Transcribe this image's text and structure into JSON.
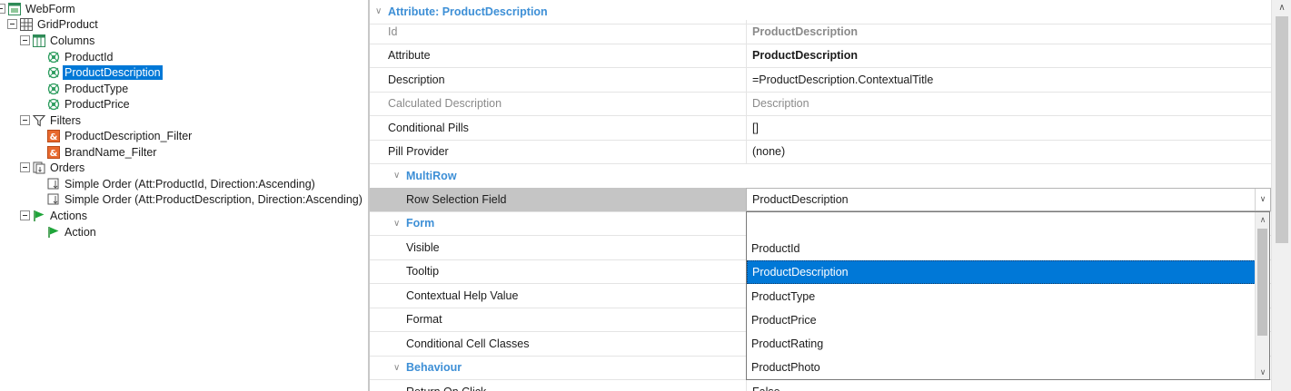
{
  "tree": {
    "root": "WebForm",
    "grid": "GridProduct",
    "columns": {
      "label": "Columns",
      "items": [
        "ProductId",
        "ProductDescription",
        "ProductType",
        "ProductPrice"
      ]
    },
    "filters": {
      "label": "Filters",
      "items": [
        "ProductDescription_Filter",
        "BrandName_Filter"
      ]
    },
    "orders": {
      "label": "Orders",
      "items": [
        "Simple Order (Att:ProductId, Direction:Ascending)",
        "Simple Order (Att:ProductDescription, Direction:Ascending)"
      ]
    },
    "actions": {
      "label": "Actions",
      "items": [
        "Action"
      ]
    }
  },
  "grid": {
    "category_title": "Attribute: ProductDescription",
    "props": [
      {
        "name": "Id",
        "value": "ProductDescription"
      },
      {
        "name": "Attribute",
        "value": "ProductDescription"
      },
      {
        "name": "Description",
        "value": "=ProductDescription.ContextualTitle"
      },
      {
        "name": "Calculated Description",
        "value": "Description"
      },
      {
        "name": "Conditional Pills",
        "value": "[]"
      },
      {
        "name": "Pill Provider",
        "value": "(none)"
      }
    ],
    "multirow": {
      "label": "MultiRow",
      "field_name": "Row Selection Field",
      "field_value": "ProductDescription"
    },
    "form": {
      "label": "Form",
      "props": [
        "Visible",
        "Tooltip",
        "Contextual Help Value",
        "Format",
        "Conditional Cell Classes"
      ]
    },
    "behaviour": {
      "label": "Behaviour",
      "props": [
        {
          "name": "Return On Click",
          "value": "False"
        }
      ]
    }
  },
  "dropdown": {
    "options": [
      "",
      "ProductId",
      "ProductDescription",
      "ProductType",
      "ProductPrice",
      "ProductRating",
      "ProductPhoto"
    ],
    "selected": "ProductDescription"
  },
  "colors": {
    "selection": "#0078d7",
    "category_text": "#3d8fd6"
  }
}
